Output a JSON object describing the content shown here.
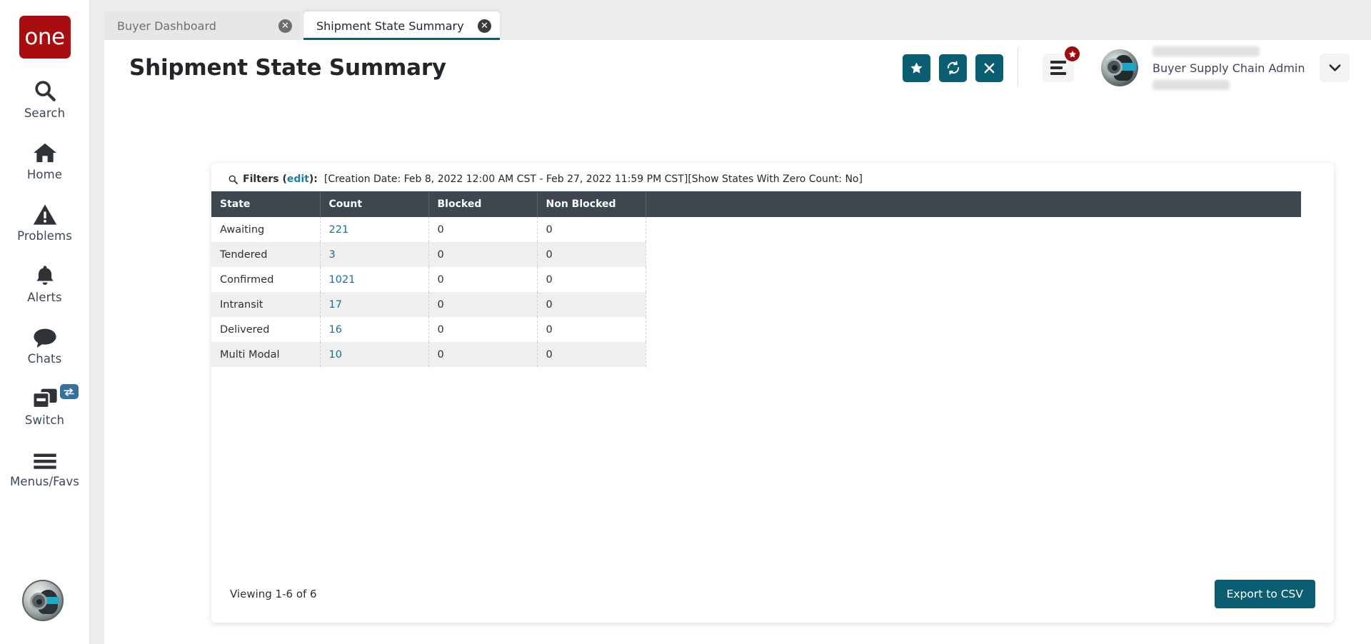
{
  "brand": {
    "logo_text": "one",
    "logo_color": "#a90d10"
  },
  "theme": {
    "accent": "#0b5e72",
    "table_header": "#3e4750",
    "link": "#1c6f92",
    "badge_red": "#a00b0b",
    "switch_badge": "#35719c"
  },
  "sidebar": {
    "items": [
      {
        "label": "Search",
        "icon": "search-icon"
      },
      {
        "label": "Home",
        "icon": "home-icon"
      },
      {
        "label": "Problems",
        "icon": "warning-triangle-icon"
      },
      {
        "label": "Alerts",
        "icon": "bell-icon"
      },
      {
        "label": "Chats",
        "icon": "chat-bubble-icon"
      },
      {
        "label": "Switch",
        "icon": "windows-stack-icon",
        "badge_icon": "swap-arrows-icon"
      },
      {
        "label": "Menus/Favs",
        "icon": "hamburger-icon"
      }
    ],
    "avatar": "user-avatar"
  },
  "tabs": [
    {
      "label": "Buyer Dashboard",
      "active": false,
      "close_icon": "close-circle-icon"
    },
    {
      "label": "Shipment State Summary",
      "active": true,
      "close_icon": "close-circle-icon"
    }
  ],
  "header": {
    "title": "Shipment State Summary",
    "actions": [
      {
        "name": "favorite-button",
        "icon": "star-icon"
      },
      {
        "name": "refresh-button",
        "icon": "refresh-icon"
      },
      {
        "name": "close-button",
        "icon": "x-icon"
      }
    ],
    "menu": {
      "icon": "hamburger-icon",
      "badge_icon": "star-icon"
    },
    "user": {
      "role": "Buyer Supply Chain Admin",
      "dropdown_icon": "chevron-down-icon"
    }
  },
  "filters": {
    "icon": "search-icon",
    "lead": "Filters (",
    "edit": "edit",
    "lead_close": "):",
    "text": "[Creation Date: Feb 8, 2022 12:00 AM CST - Feb 27, 2022 11:59 PM CST][Show States With Zero Count: No]"
  },
  "table": {
    "columns": [
      "State",
      "Count",
      "Blocked",
      "Non Blocked"
    ],
    "rows": [
      {
        "state": "Awaiting",
        "count": "221",
        "blocked": "0",
        "non_blocked": "0"
      },
      {
        "state": "Tendered",
        "count": "3",
        "blocked": "0",
        "non_blocked": "0"
      },
      {
        "state": "Confirmed",
        "count": "1021",
        "blocked": "0",
        "non_blocked": "0"
      },
      {
        "state": "Intransit",
        "count": "17",
        "blocked": "0",
        "non_blocked": "0"
      },
      {
        "state": "Delivered",
        "count": "16",
        "blocked": "0",
        "non_blocked": "0"
      },
      {
        "state": "Multi Modal",
        "count": "10",
        "blocked": "0",
        "non_blocked": "0"
      }
    ]
  },
  "footer": {
    "viewing": "Viewing 1-6 of 6",
    "export_label": "Export to CSV"
  }
}
